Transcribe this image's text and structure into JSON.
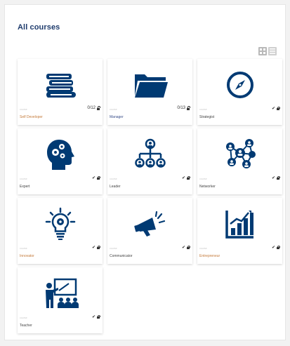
{
  "page": {
    "title": "All courses"
  },
  "view_toggle": {
    "grid_icon": "grid-view-icon",
    "list_icon": "list-view-icon"
  },
  "colors": {
    "icon": "#003a73",
    "title": "#1f3c6d"
  },
  "courses": [
    {
      "name": "Self Developer",
      "category": "course",
      "status": "0/12",
      "status_icon": "lock-icon",
      "icon": "books-icon",
      "name_color": "orange"
    },
    {
      "name": "Manager",
      "category": "course",
      "status": "0/13",
      "status_icon": "lock-icon",
      "icon": "folder-icon",
      "name_color": "blue"
    },
    {
      "name": "Strategist",
      "category": "course",
      "status": "✔",
      "status_icon": "lock-icon",
      "icon": "compass-icon",
      "name_color": "default"
    },
    {
      "name": "Expert",
      "category": "course",
      "status": "✔",
      "status_icon": "lock-icon",
      "icon": "head-gears-icon",
      "name_color": "default"
    },
    {
      "name": "Leader",
      "category": "course",
      "status": "✔",
      "status_icon": "lock-icon",
      "icon": "org-chart-icon",
      "name_color": "default"
    },
    {
      "name": "Networker",
      "category": "course",
      "status": "✔",
      "status_icon": "lock-icon",
      "icon": "network-icon",
      "name_color": "default"
    },
    {
      "name": "Innovator",
      "category": "course",
      "status": "✔",
      "status_icon": "lock-icon",
      "icon": "lightbulb-gear-icon",
      "name_color": "orange"
    },
    {
      "name": "Communicator",
      "category": "course",
      "status": "✔",
      "status_icon": "lock-icon",
      "icon": "megaphone-icon",
      "name_color": "default"
    },
    {
      "name": "Entrepreneur",
      "category": "course",
      "status": "✔",
      "status_icon": "lock-icon",
      "icon": "bar-chart-icon",
      "name_color": "orange"
    },
    {
      "name": "Teacher",
      "category": "course",
      "status": "✔",
      "status_icon": "lock-icon",
      "icon": "teacher-icon",
      "name_color": "default"
    }
  ]
}
